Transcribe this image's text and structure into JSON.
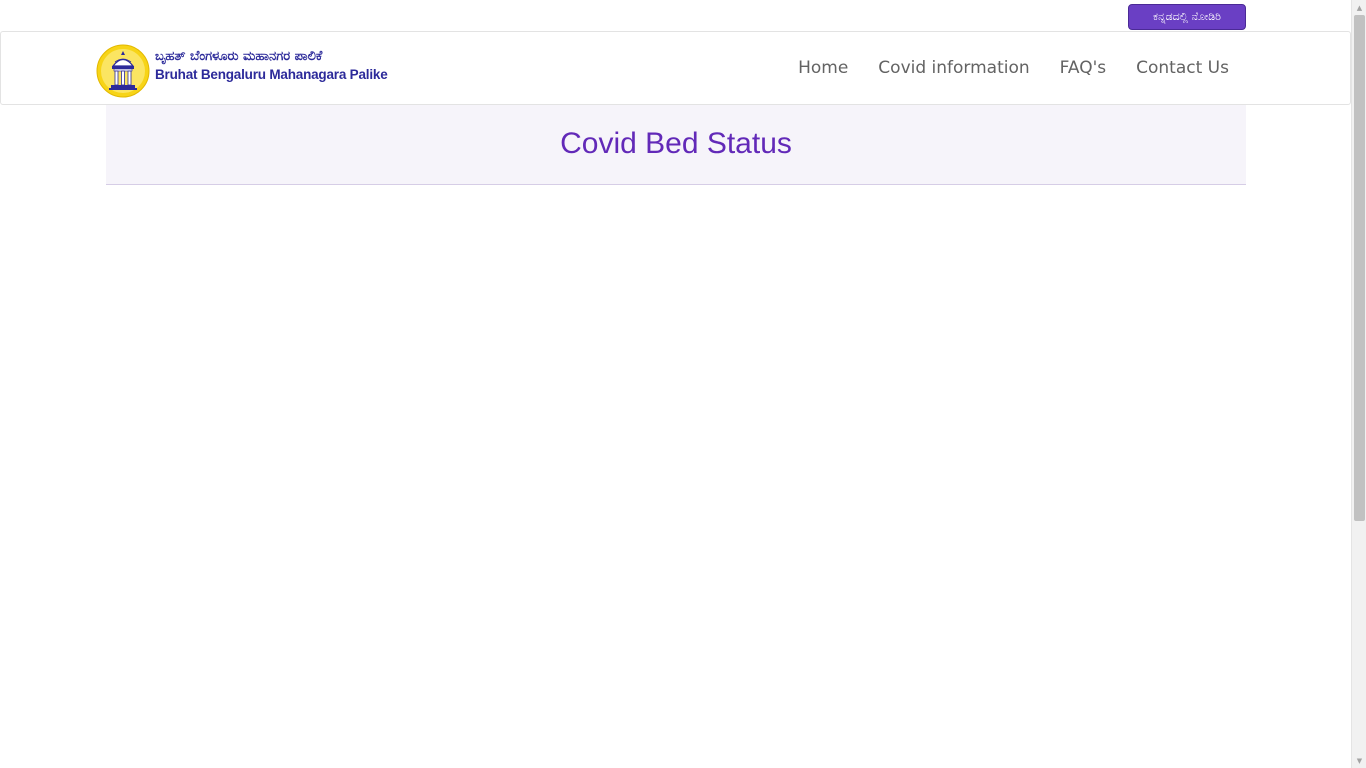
{
  "header": {
    "language_button_label": "ಕನ್ನಡದಲ್ಲಿ ನೋಡಿರಿ"
  },
  "brand": {
    "name_kannada": "ಬೃಹತ್ ಬೆಂಗಳೂರು ಮಹಾನಗರ ಪಾಲಿಕೆ",
    "name_english": "Bruhat Bengaluru Mahanagara Palike",
    "emblem_icon": "bbmp-emblem-icon",
    "colors": {
      "emblem_yellow": "#f7d417",
      "text_blue": "#2c2a9a"
    }
  },
  "nav": {
    "items": [
      {
        "label": "Home"
      },
      {
        "label": "Covid information"
      },
      {
        "label": "FAQ's"
      },
      {
        "label": "Contact Us"
      }
    ]
  },
  "main": {
    "title": "Covid Bed Status"
  },
  "theme": {
    "accent": "#6a3fc4",
    "title_color": "#6229b8",
    "panel_background": "#f6f4fa",
    "nav_text": "#636363"
  }
}
